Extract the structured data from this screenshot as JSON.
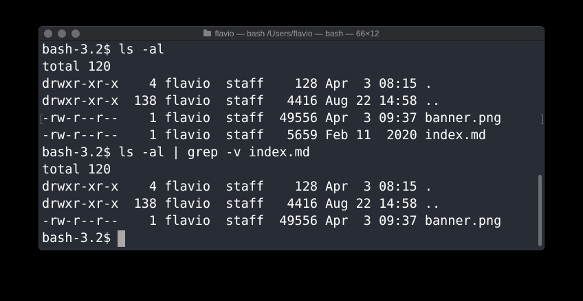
{
  "window": {
    "title": "flavio — bash /Users/flavio — bash — 66×12"
  },
  "terminal": {
    "lines": [
      "bash-3.2$ ls -al",
      "total 120",
      "drwxr-xr-x    4 flavio  staff    128 Apr  3 08:15 .",
      "drwxr-xr-x  138 flavio  staff   4416 Aug 22 14:58 ..",
      "-rw-r--r--    1 flavio  staff  49556 Apr  3 09:37 banner.png",
      "-rw-r--r--    1 flavio  staff   5659 Feb 11  2020 index.md",
      "bash-3.2$ ls -al | grep -v index.md",
      "total 120",
      "drwxr-xr-x    4 flavio  staff    128 Apr  3 08:15 .",
      "drwxr-xr-x  138 flavio  staff   4416 Aug 22 14:58 ..",
      "-rw-r--r--    1 flavio  staff  49556 Apr  3 09:37 banner.png",
      "bash-3.2$ "
    ]
  }
}
